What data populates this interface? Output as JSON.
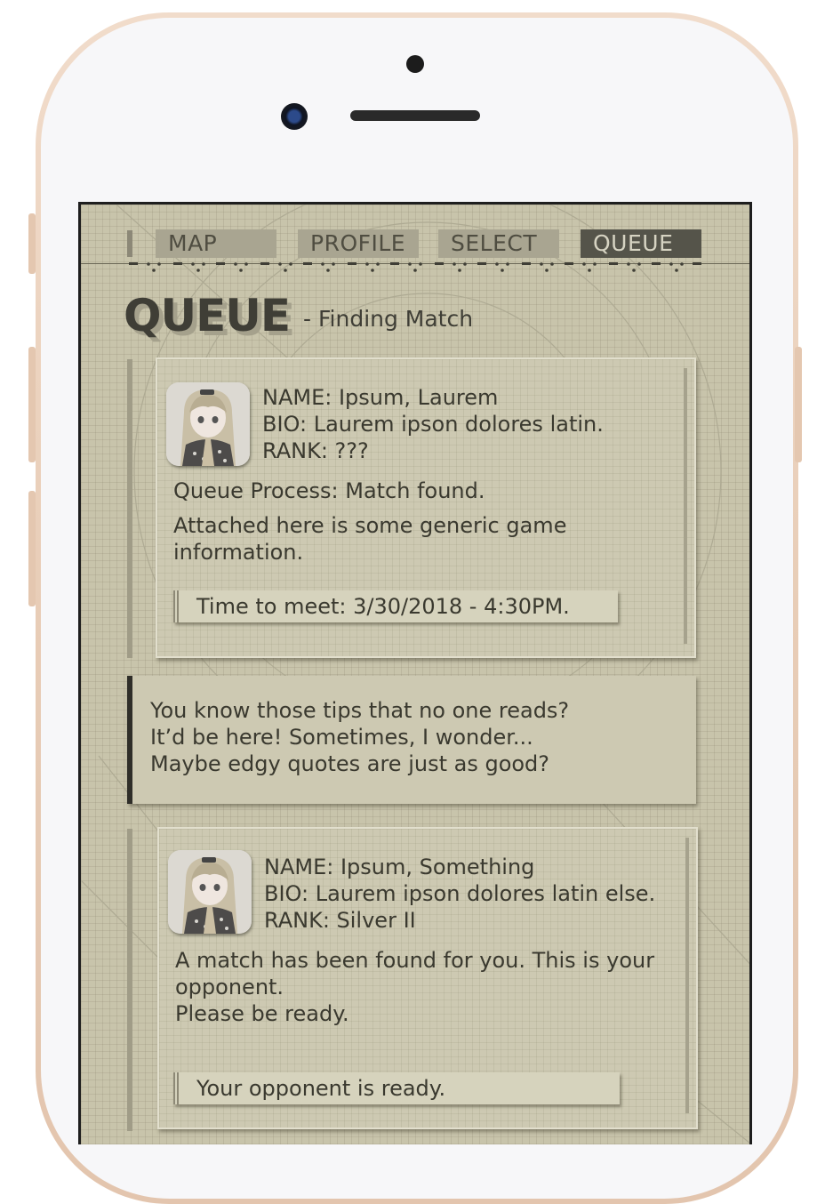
{
  "nav": {
    "tabs": [
      {
        "label": "MAP"
      },
      {
        "label": "PROFILE"
      },
      {
        "label": "SELECT"
      },
      {
        "label": "QUEUE"
      }
    ],
    "active_tab": "QUEUE"
  },
  "page": {
    "title": "QUEUE",
    "subtitle": "- Finding Match"
  },
  "cards": [
    {
      "name": "NAME: Ipsum, Laurem",
      "bio": "BIO: Laurem ipson dolores latin.",
      "rank": "RANK: ???",
      "line1": "Queue Process: Match found.",
      "line2": "Attached here is some generic game",
      "line3": "information.",
      "ticket": "Time to meet: 3/30/2018 - 4:30PM."
    },
    {
      "name": "NAME: Ipsum, Something",
      "bio": "BIO: Laurem ipson dolores latin else.",
      "rank": "RANK: Silver II",
      "line1": "A match has been found for you. This is your",
      "line2": "opponent.",
      "line3": "Please be ready.",
      "ticket": "Your opponent is ready."
    }
  ],
  "tip": {
    "line1": "You know those tips that no one reads?",
    "line2": "It’d be here! Sometimes, I wonder...",
    "line3": "Maybe edgy quotes are just as good?"
  },
  "colors": {
    "screen_bg": "#c8c4ab",
    "tab_bg": "#a9a591",
    "tab_active_bg": "#55544a",
    "text": "#3a392f"
  }
}
